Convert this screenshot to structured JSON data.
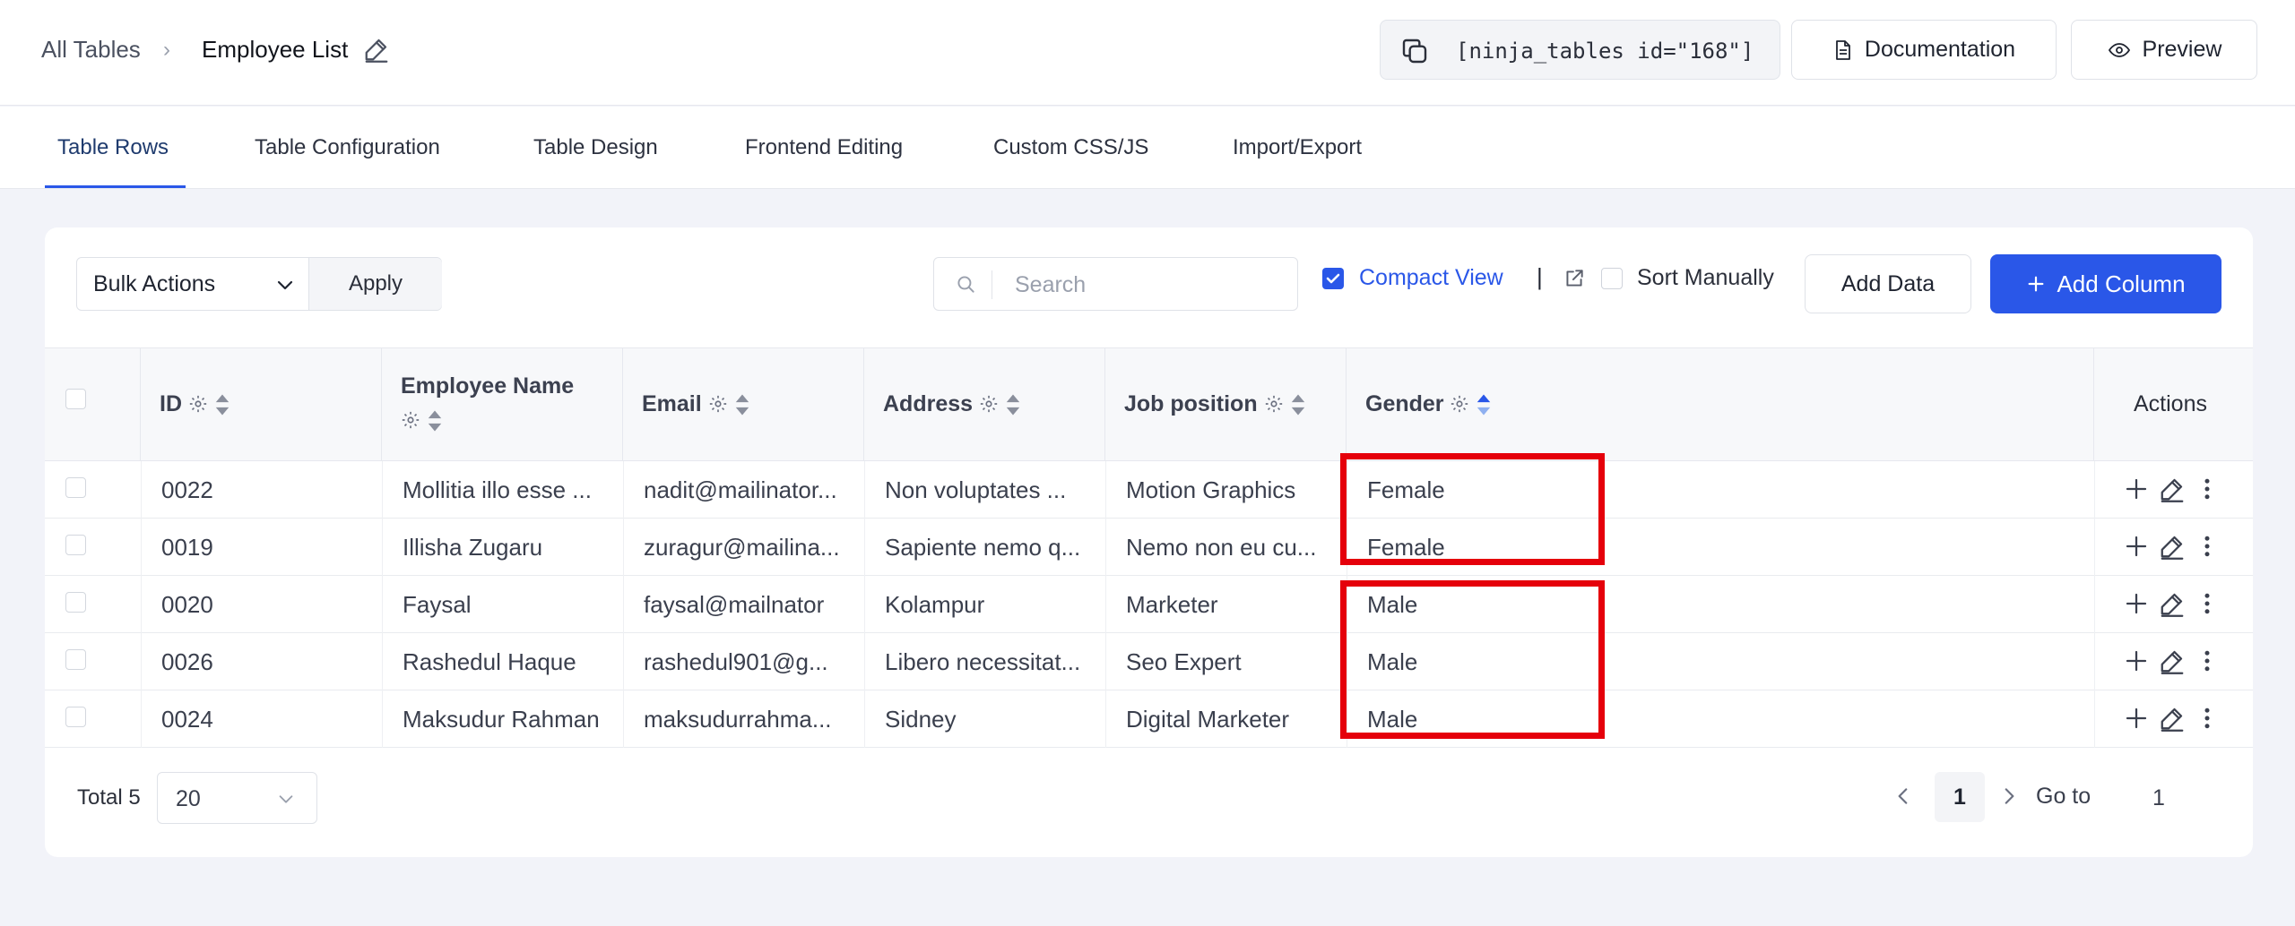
{
  "breadcrumb": {
    "root": "All Tables",
    "current": "Employee List"
  },
  "header": {
    "shortcode": "[ninja_tables id=\"168\"]",
    "documentation_label": "Documentation",
    "preview_label": "Preview"
  },
  "tabs": [
    {
      "label": "Table Rows",
      "active": true
    },
    {
      "label": "Table Configuration"
    },
    {
      "label": "Table Design"
    },
    {
      "label": "Frontend Editing"
    },
    {
      "label": "Custom CSS/JS"
    },
    {
      "label": "Import/Export"
    }
  ],
  "toolbar": {
    "bulk_actions": "Bulk Actions",
    "apply_label": "Apply",
    "search_placeholder": "Search",
    "compact_view_label": "Compact View",
    "compact_view_checked": true,
    "separator": "|",
    "sort_manually_label": "Sort Manually",
    "sort_manually_checked": false,
    "add_data_label": "Add Data",
    "add_column_label": "Add Column"
  },
  "table": {
    "columns": [
      "ID",
      "Employee Name",
      "Email",
      "Address",
      "Job position",
      "Gender",
      "Actions"
    ],
    "rows": [
      {
        "id": "0022",
        "name": "Mollitia illo esse ...",
        "email": "nadit@mailinator...",
        "address": "Non voluptates ...",
        "job": "Motion Graphics",
        "gender": "Female"
      },
      {
        "id": "0019",
        "name": "Illisha Zugaru",
        "email": "zuragur@mailina...",
        "address": "Sapiente nemo q...",
        "job": "Nemo non eu cu...",
        "gender": "Female"
      },
      {
        "id": "0020",
        "name": "Faysal",
        "email": "faysal@mailnator",
        "address": "Kolampur",
        "job": "Marketer",
        "gender": "Male"
      },
      {
        "id": "0026",
        "name": "Rashedul Haque",
        "email": "rashedul901@g...",
        "address": "Libero necessitat...",
        "job": "Seo Expert",
        "gender": "Male"
      },
      {
        "id": "0024",
        "name": "Maksudur Rahman",
        "email": "maksudurrahma...",
        "address": "Sidney",
        "job": "Digital Marketer",
        "gender": "Male"
      }
    ]
  },
  "footer": {
    "total_label": "Total 5",
    "page_size": "20",
    "current_page": "1",
    "goto_label": "Go to",
    "goto_value": "1"
  },
  "colors": {
    "accent": "#2a57e8",
    "highlight": "#e5000b"
  }
}
